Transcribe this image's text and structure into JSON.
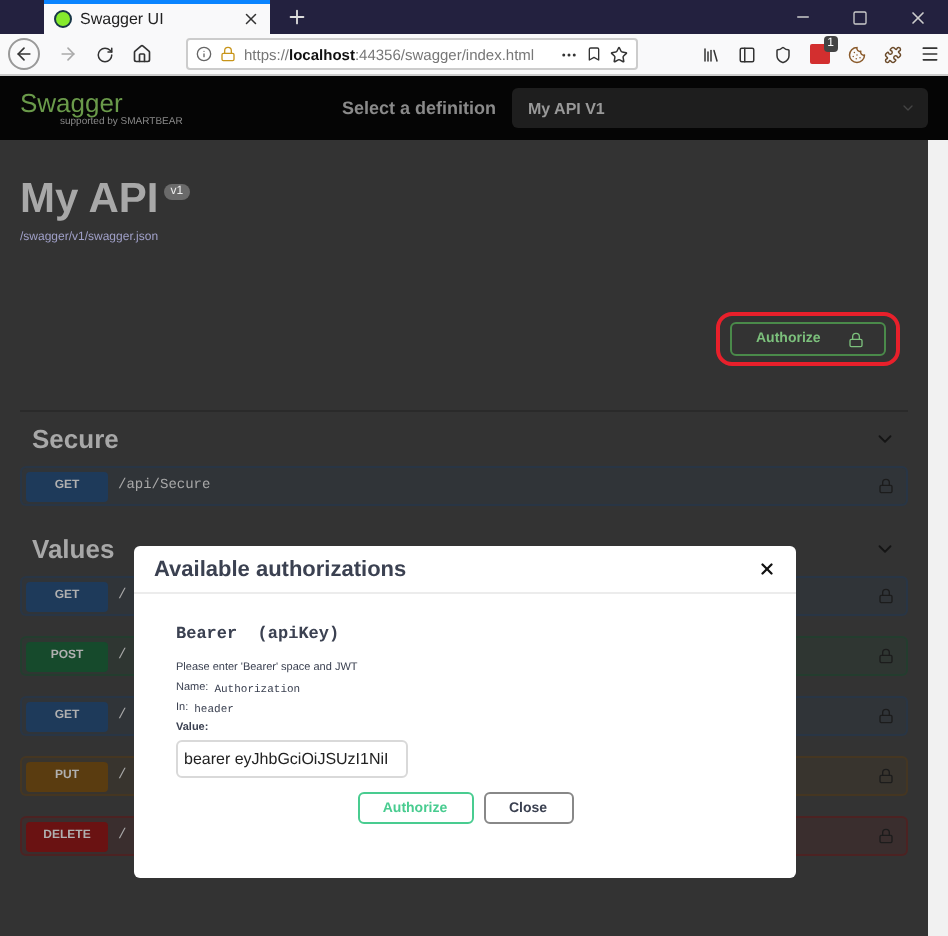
{
  "browser": {
    "tab_title": "Swagger UI",
    "url_scheme": "https://",
    "url_host": "localhost",
    "url_rest": ":44356/swagger/index.html",
    "extension_badge": "1"
  },
  "header": {
    "logo_text": "Swagger",
    "logo_sub": "supported by SMARTBEAR",
    "definition_label": "Select a definition",
    "definition_value": "My API V1"
  },
  "info": {
    "title": "My API",
    "version": "v1",
    "link": "/swagger/v1/swagger.json"
  },
  "authorize_button": {
    "label": "Authorize",
    "highlighted": true
  },
  "sections": [
    {
      "name": "Secure",
      "expanded": true,
      "operations": [
        {
          "method": "GET",
          "path": "/api/Secure"
        }
      ]
    },
    {
      "name": "Values",
      "expanded": true,
      "operations": [
        {
          "method": "GET",
          "path": "/"
        },
        {
          "method": "POST",
          "path": "/"
        },
        {
          "method": "GET",
          "path": "/"
        },
        {
          "method": "PUT",
          "path": "/"
        },
        {
          "method": "DELETE",
          "path": "/"
        }
      ]
    }
  ],
  "modal": {
    "title": "Available authorizations",
    "scheme_title": "Bearer  (apiKey)",
    "description": "Please enter 'Bearer' space and JWT",
    "name_label": "Name:",
    "name_value": "Authorization",
    "in_label": "In:",
    "in_value": "header",
    "value_label": "Value:",
    "value": "bearer eyJhbGciOiJSUzI1NiI",
    "buttons": [
      {
        "label": "Authorize",
        "kind": "primary"
      },
      {
        "label": "Close",
        "kind": "secondary"
      }
    ]
  }
}
